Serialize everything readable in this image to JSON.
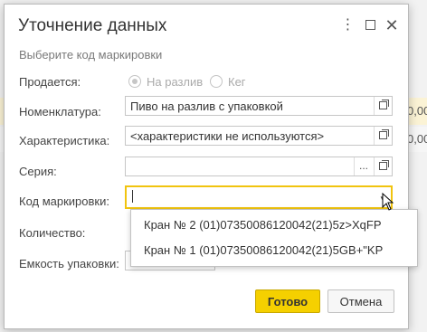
{
  "background": {
    "row1_value": "0,00",
    "row2_value": "0,00"
  },
  "dialog": {
    "title": "Уточнение данных",
    "hint": "Выберите код маркировки",
    "sold": {
      "label": "Продается:",
      "options": [
        "На разлив",
        "Кег"
      ],
      "selected": "На разлив"
    },
    "nomenclature": {
      "label": "Номенклатура:",
      "value": "Пиво на разлив с упаковкой"
    },
    "characteristic": {
      "label": "Характеристика:",
      "value": "<характеристики не используются>"
    },
    "series": {
      "label": "Серия:",
      "value": "",
      "select_button": "..."
    },
    "marking_code": {
      "label": "Код маркировки:",
      "value": ""
    },
    "quantity": {
      "label": "Количество:"
    },
    "package_capacity": {
      "label": "Емкость упаковки:"
    },
    "dropdown": {
      "items": [
        "Кран № 2 (01)07350086120042(21)5z>XqFP",
        "Кран № 1 (01)07350086120042(21)5GB+\"KP"
      ]
    },
    "buttons": {
      "ok": "Готово",
      "cancel": "Отмена"
    }
  },
  "colors": {
    "accent": "#f5d000",
    "focus_border": "#f1c40f",
    "row_highlight": "#fbf3d5"
  }
}
